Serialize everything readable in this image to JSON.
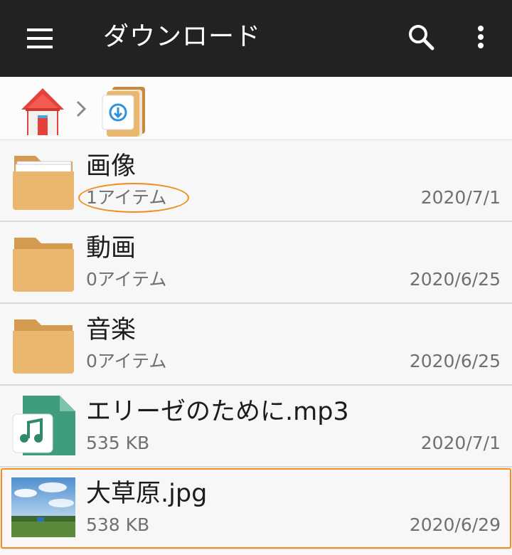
{
  "appbar": {
    "title": "ダウンロード",
    "menu_icon": "hamburger-menu-icon",
    "search_icon": "search-icon",
    "more_icon": "more-vert-icon"
  },
  "breadcrumb": {
    "home_icon": "home-icon",
    "separator_icon": "chevron-right-icon",
    "current_icon": "download-folder-icon"
  },
  "files": [
    {
      "name": "画像",
      "meta": "1アイテム",
      "date": "2020/7/1",
      "type": "folder"
    },
    {
      "name": "動画",
      "meta": "0アイテム",
      "date": "2020/6/25",
      "type": "folder"
    },
    {
      "name": "音楽",
      "meta": "0アイテム",
      "date": "2020/6/25",
      "type": "folder"
    },
    {
      "name": "エリーゼのために.mp3",
      "meta": "535 KB",
      "date": "2020/7/1",
      "type": "audio"
    },
    {
      "name": "大草原.jpg",
      "meta": "538 KB",
      "date": "2020/6/29",
      "type": "image"
    }
  ],
  "colors": {
    "appbar_bg": "#222321",
    "highlight": "#f28c1a",
    "folder": "#e8b56f",
    "audio_file": "#3f9c7c"
  }
}
